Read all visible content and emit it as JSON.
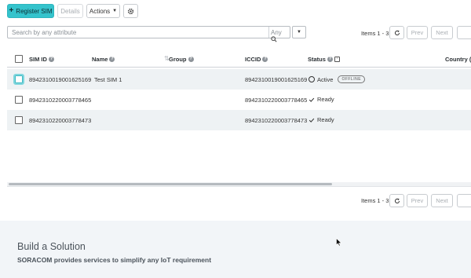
{
  "toolbar": {
    "register_label": "Register SIM",
    "details_label": "Details",
    "actions_label": "Actions"
  },
  "search": {
    "placeholder": "Search by any attribute",
    "scope": "Any"
  },
  "pager": {
    "items_label": "Items 1 - 3",
    "prev_label": "Prev",
    "next_label": "Next"
  },
  "table": {
    "headers": {
      "sim_id": "SIM ID",
      "name": "Name",
      "group": "Group",
      "iccid": "ICCID",
      "status": "Status",
      "country": "Country ("
    },
    "rows": [
      {
        "sim_id": "8942310019001625169",
        "name": "Test SIM 1",
        "group": "",
        "iccid": "8942310019001625169",
        "status": "Active",
        "badge": "OFFLINE"
      },
      {
        "sim_id": "8942310220003778465",
        "name": "",
        "group": "",
        "iccid": "8942310220003778465",
        "status": "Ready",
        "badge": ""
      },
      {
        "sim_id": "8942310220003778473",
        "name": "",
        "group": "",
        "iccid": "8942310220003778473",
        "status": "Ready",
        "badge": ""
      }
    ]
  },
  "footer": {
    "title": "Build a Solution",
    "subtitle": "SORACOM provides services to simplify any IoT requirement"
  },
  "colors": {
    "primary": "#34c3cc",
    "row_alt": "#eef2f4",
    "footer_bg": "#f2f5f8"
  },
  "icons": [
    "plus-icon",
    "caret-down-icon",
    "gear-icon",
    "search-icon",
    "refresh-icon",
    "help-icon",
    "sort-icon",
    "checkmark-icon",
    "status-ring-icon",
    "mouse-cursor-icon"
  ]
}
